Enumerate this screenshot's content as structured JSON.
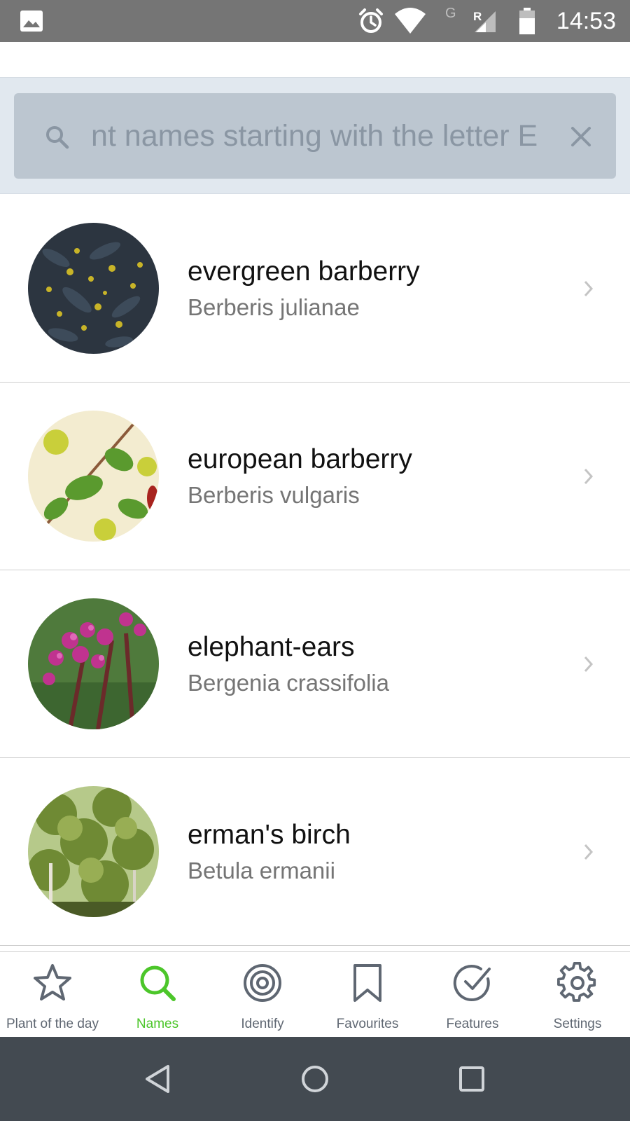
{
  "status_bar": {
    "time": "14:53",
    "network_label": "G",
    "roaming_label": "R"
  },
  "search": {
    "placeholder": "nt names starting with the letter E",
    "icon": "search-icon",
    "clear_icon": "close-icon"
  },
  "plants": [
    {
      "common_name": "evergreen barberry",
      "latin_name": "Berberis julianae"
    },
    {
      "common_name": "european barberry",
      "latin_name": "Berberis vulgaris"
    },
    {
      "common_name": "elephant-ears",
      "latin_name": "Bergenia crassifolia"
    },
    {
      "common_name": "erman's birch",
      "latin_name": "Betula ermanii"
    }
  ],
  "bottom_nav": {
    "active": "Names",
    "accent_color": "#4cc62a",
    "items": [
      {
        "label": "Plant of the day",
        "icon": "star-icon"
      },
      {
        "label": "Names",
        "icon": "search-icon"
      },
      {
        "label": "Identify",
        "icon": "target-icon"
      },
      {
        "label": "Favourites",
        "icon": "bookmark-icon"
      },
      {
        "label": "Features",
        "icon": "check-circle-icon"
      },
      {
        "label": "Settings",
        "icon": "gear-icon"
      }
    ]
  },
  "system_nav": {
    "buttons": [
      "back-icon",
      "home-icon",
      "recents-icon"
    ]
  }
}
